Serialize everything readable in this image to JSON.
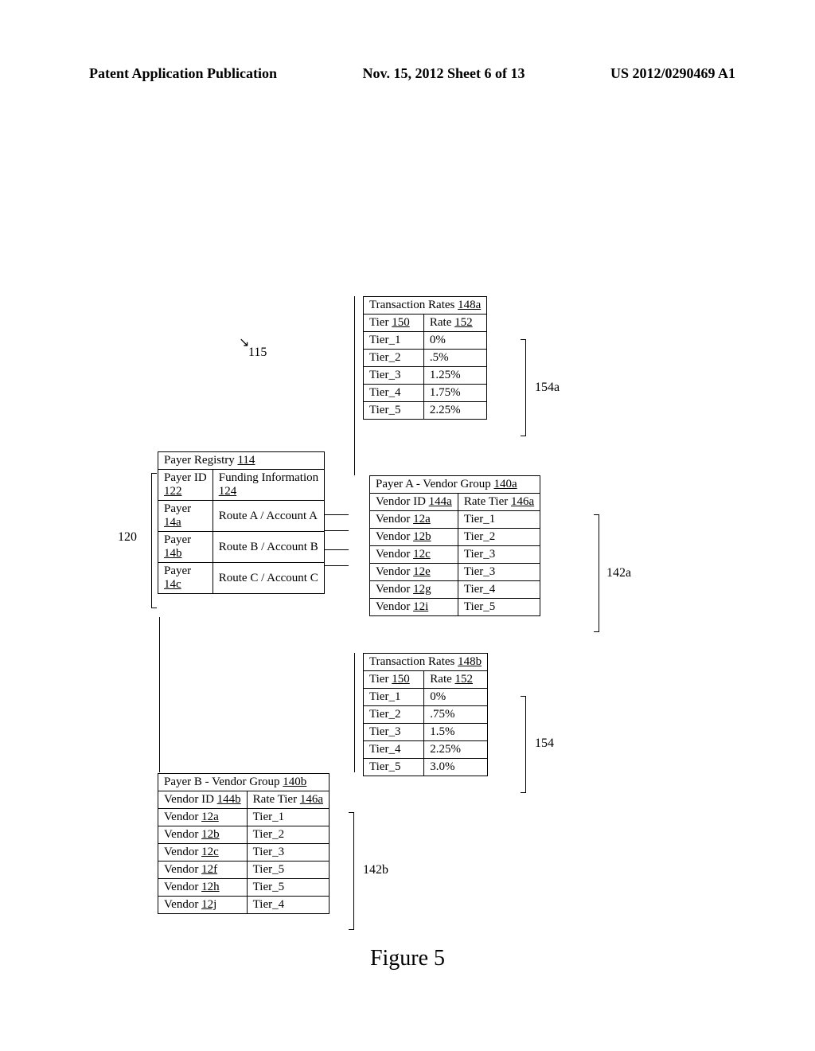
{
  "header": {
    "left": "Patent Application Publication",
    "center": "Nov. 15, 2012  Sheet 6 of 13",
    "right": "US 2012/0290469 A1"
  },
  "labels": {
    "ref115": "115",
    "ref120": "120",
    "ref142a": "142a",
    "ref142b": "142b",
    "ref154a": "154a",
    "ref154": "154"
  },
  "payer_registry": {
    "title": "Payer Registry ",
    "title_ref": "114",
    "col1_label": "Payer ID ",
    "col1_ref": "122",
    "col2_label": "Funding Information ",
    "col2_ref": "124",
    "rows": [
      {
        "id_label": "Payer ",
        "id_ref": "14a",
        "funding": "Route A / Account A"
      },
      {
        "id_label": "Payer ",
        "id_ref": "14b",
        "funding": "Route B / Account B"
      },
      {
        "id_label": "Payer ",
        "id_ref": "14c",
        "funding": "Route C / Account C"
      }
    ]
  },
  "rates_a": {
    "title": "Transaction Rates ",
    "title_ref": "148a",
    "tier_label": "Tier ",
    "tier_ref": "150",
    "rate_label": "Rate ",
    "rate_ref": "152",
    "rows": [
      {
        "tier": "Tier_1",
        "rate": "0%"
      },
      {
        "tier": "Tier_2",
        "rate": ".5%"
      },
      {
        "tier": "Tier_3",
        "rate": "1.25%"
      },
      {
        "tier": "Tier_4",
        "rate": "1.75%"
      },
      {
        "tier": "Tier_5",
        "rate": "2.25%"
      }
    ]
  },
  "vendor_group_a": {
    "title": "Payer A - Vendor Group ",
    "title_ref": "140a",
    "vid_label": "Vendor ID ",
    "vid_ref": "144a",
    "rt_label": "Rate Tier ",
    "rt_ref": "146a",
    "rows": [
      {
        "vid_label": "Vendor ",
        "vid_ref": "12a",
        "tier": "Tier_1"
      },
      {
        "vid_label": "Vendor ",
        "vid_ref": "12b",
        "tier": "Tier_2"
      },
      {
        "vid_label": "Vendor ",
        "vid_ref": "12c",
        "tier": "Tier_3"
      },
      {
        "vid_label": "Vendor ",
        "vid_ref": "12e",
        "tier": "Tier_3"
      },
      {
        "vid_label": "Vendor ",
        "vid_ref": "12g",
        "tier": "Tier_4"
      },
      {
        "vid_label": "Vendor ",
        "vid_ref": "12i",
        "tier": "Tier_5"
      }
    ]
  },
  "rates_b": {
    "title": "Transaction Rates ",
    "title_ref": "148b",
    "tier_label": "Tier ",
    "tier_ref": "150",
    "rate_label": "Rate ",
    "rate_ref": "152",
    "rows": [
      {
        "tier": "Tier_1",
        "rate": "0%"
      },
      {
        "tier": "Tier_2",
        "rate": ".75%"
      },
      {
        "tier": "Tier_3",
        "rate": "1.5%"
      },
      {
        "tier": "Tier_4",
        "rate": "2.25%"
      },
      {
        "tier": "Tier_5",
        "rate": "3.0%"
      }
    ]
  },
  "vendor_group_b": {
    "title": "Payer B - Vendor Group ",
    "title_ref": "140b",
    "vid_label": "Vendor ID ",
    "vid_ref": "144b",
    "rt_label": "Rate Tier ",
    "rt_ref": "146a",
    "rows": [
      {
        "vid_label": "Vendor ",
        "vid_ref": "12a",
        "tier": "Tier_1"
      },
      {
        "vid_label": "Vendor ",
        "vid_ref": "12b",
        "tier": "Tier_2"
      },
      {
        "vid_label": "Vendor ",
        "vid_ref": "12c",
        "tier": "Tier_3"
      },
      {
        "vid_label": "Vendor ",
        "vid_ref": "12f",
        "tier": "Tier_5"
      },
      {
        "vid_label": "Vendor ",
        "vid_ref": "12h",
        "tier": "Tier_5"
      },
      {
        "vid_label": "Vendor ",
        "vid_ref": "12j",
        "tier": "Tier_4"
      }
    ]
  },
  "figure_caption": "Figure 5"
}
